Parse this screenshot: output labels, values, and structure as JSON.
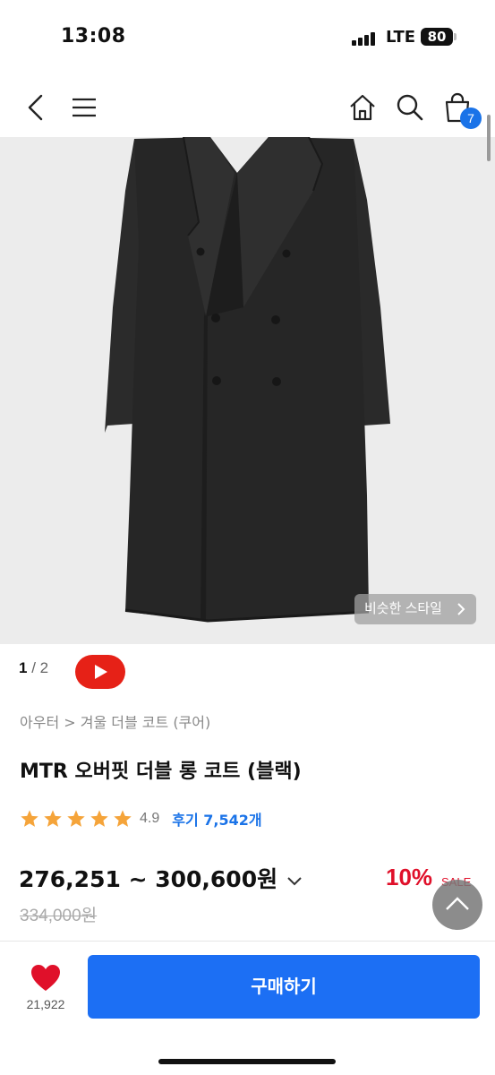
{
  "status_bar": {
    "time": "13:08",
    "network": "LTE",
    "battery": "80"
  },
  "nav": {
    "cart_count": "7"
  },
  "image": {
    "similar_style_label": "비슷한 스타일"
  },
  "pager": {
    "current": "1",
    "separator": " / ",
    "total": "2"
  },
  "breadcrumb": "아우터 > 겨울 더블 코트 (쿠어)",
  "product": {
    "title": "MTR 오버핏 더블 롱 코트 (블랙)",
    "rating": "4.9",
    "rating_stars": 5,
    "reviews_label": "후기 7,542개",
    "price_range": "276,251 ~ 300,600원",
    "original_price": "334,000원",
    "discount": "10%",
    "sale_label": "SALE"
  },
  "bottom": {
    "like_count": "21,922",
    "buy_label": "구매하기"
  },
  "colors": {
    "accent": "#1c6ff4",
    "sale": "#e0102a",
    "youtube": "#e62117",
    "star": "#f5a43a"
  }
}
